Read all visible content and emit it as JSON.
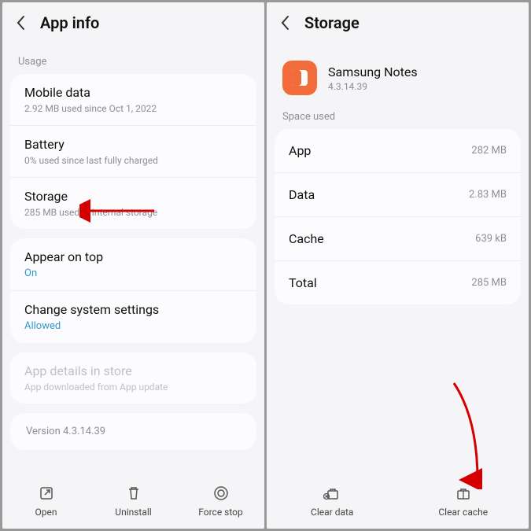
{
  "left": {
    "title": "App info",
    "usage_label": "Usage",
    "mobile_data": {
      "label": "Mobile data",
      "sub": "2.92 MB used since Oct 1, 2022"
    },
    "battery": {
      "label": "Battery",
      "sub": "0% used since last fully charged"
    },
    "storage": {
      "label": "Storage",
      "sub": "285 MB used in Internal storage"
    },
    "appear_on_top": {
      "label": "Appear on top",
      "value": "On"
    },
    "change_sys": {
      "label": "Change system settings",
      "value": "Allowed"
    },
    "app_details": {
      "label": "App details in store",
      "sub": "App downloaded from App update"
    },
    "version": "Version 4.3.14.39",
    "buttons": {
      "open": "Open",
      "uninstall": "Uninstall",
      "force_stop": "Force stop"
    }
  },
  "right": {
    "title": "Storage",
    "app": {
      "name": "Samsung Notes",
      "version": "4.3.14.39"
    },
    "space_used_label": "Space used",
    "rows": {
      "app": {
        "label": "App",
        "value": "282 MB"
      },
      "data": {
        "label": "Data",
        "value": "2.83 MB"
      },
      "cache": {
        "label": "Cache",
        "value": "639 kB"
      },
      "total": {
        "label": "Total",
        "value": "285 MB"
      }
    },
    "buttons": {
      "clear_data": "Clear data",
      "clear_cache": "Clear cache"
    }
  }
}
